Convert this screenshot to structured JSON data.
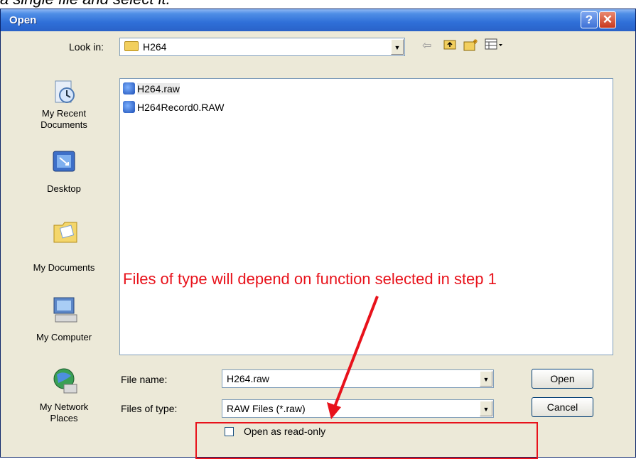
{
  "caption_top": "a single file and select it.",
  "dialog": {
    "title": "Open",
    "help_glyph": "?",
    "close_glyph": "✕"
  },
  "look_in": {
    "label": "Look in:",
    "value": "H264"
  },
  "places": [
    {
      "label_line1": "My Recent",
      "label_line2": "Documents",
      "icon": "recent-documents-icon"
    },
    {
      "label_line1": "Desktop",
      "label_line2": "",
      "icon": "desktop-icon"
    },
    {
      "label_line1": "My Documents",
      "label_line2": "",
      "icon": "my-documents-icon"
    },
    {
      "label_line1": "My Computer",
      "label_line2": "",
      "icon": "my-computer-icon"
    },
    {
      "label_line1": "My Network",
      "label_line2": "Places",
      "icon": "network-places-icon"
    }
  ],
  "files": [
    {
      "name": "H264.raw",
      "selected": true
    },
    {
      "name": "H264Record0.RAW",
      "selected": false
    }
  ],
  "file_name": {
    "label": "File name:",
    "value": "H264.raw"
  },
  "file_type": {
    "label": "Files of type:",
    "value": "RAW Files (*.raw)"
  },
  "read_only": {
    "label": "Open as read-only",
    "checked": false
  },
  "buttons": {
    "open": "Open",
    "cancel": "Cancel"
  },
  "annotation": {
    "text": "Files of type will depend on function selected in step 1",
    "color": "#e8121b"
  }
}
